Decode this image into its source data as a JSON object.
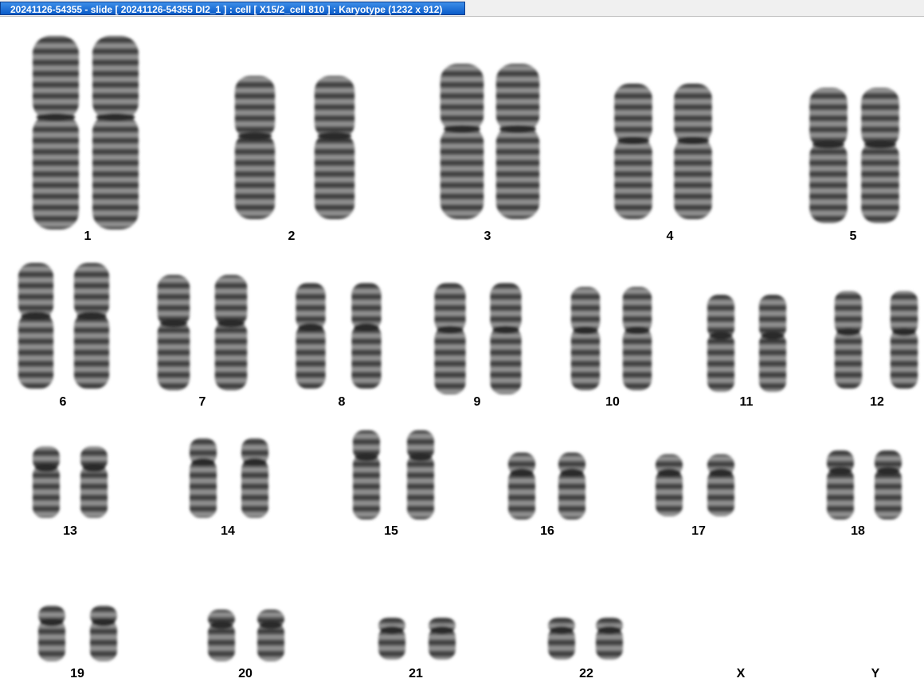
{
  "window": {
    "title": "20241126-54355 - slide [ 20241126-54355 DI2_1 ] : cell [ X15/2_cell 810 ] : Karyotype  (1232 x 912)"
  },
  "karyotype": {
    "chromosomes": [
      {
        "label": "1"
      },
      {
        "label": "2"
      },
      {
        "label": "3"
      },
      {
        "label": "4"
      },
      {
        "label": "5"
      },
      {
        "label": "6"
      },
      {
        "label": "7"
      },
      {
        "label": "8"
      },
      {
        "label": "9"
      },
      {
        "label": "10"
      },
      {
        "label": "11"
      },
      {
        "label": "12"
      },
      {
        "label": "13"
      },
      {
        "label": "14"
      },
      {
        "label": "15"
      },
      {
        "label": "16"
      },
      {
        "label": "17"
      },
      {
        "label": "18"
      },
      {
        "label": "19"
      },
      {
        "label": "20"
      },
      {
        "label": "21"
      },
      {
        "label": "22"
      },
      {
        "label": "X"
      },
      {
        "label": "Y"
      }
    ]
  }
}
